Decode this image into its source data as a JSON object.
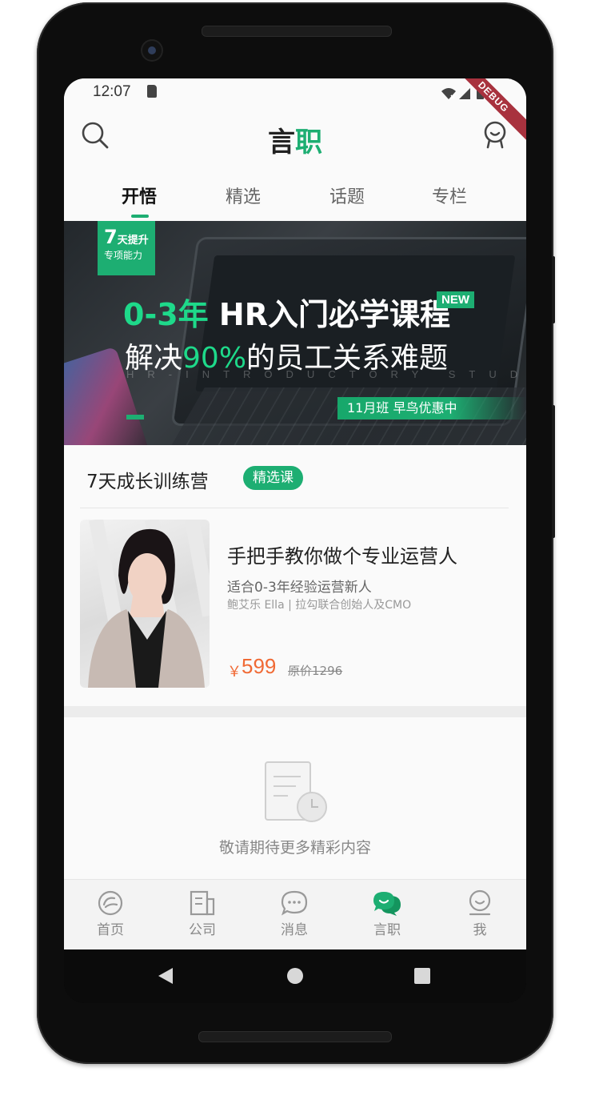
{
  "status_bar": {
    "time": "12:07",
    "debug_label": "DEBUG"
  },
  "app_bar": {
    "title_part1": "言",
    "title_part2": "职"
  },
  "tabs": [
    {
      "label": "开悟",
      "active": true
    },
    {
      "label": "精选",
      "active": false
    },
    {
      "label": "话题",
      "active": false
    },
    {
      "label": "专栏",
      "active": false
    }
  ],
  "banner": {
    "badge_num": "7",
    "badge_line1": "天提升",
    "badge_line2": "专项能力",
    "headline_accent": "0-3年",
    "headline_rest": " HR入门必学课程",
    "new_tag": "NEW",
    "subline_a": "解决",
    "subline_accent": "90%",
    "subline_b": "的员工关系难题",
    "watermark": "HR-INTRODUCTORY STUDY",
    "promo": "11月班 早鸟优惠中"
  },
  "section": {
    "title": "7天成长训练营",
    "badge": "精选课",
    "course": {
      "title": "手把手教你做个专业运营人",
      "desc": "适合0-3年经验运营新人",
      "author": "鲍艾乐 Ella | 拉勾联合创始人及CMO",
      "price_currency": "￥",
      "price": "599",
      "original_price": "原价1296"
    }
  },
  "empty_state": {
    "text": "敬请期待更多精彩内容"
  },
  "bottom_nav": [
    {
      "label": "首页",
      "icon": "home-icon",
      "active": false
    },
    {
      "label": "公司",
      "icon": "company-icon",
      "active": false
    },
    {
      "label": "消息",
      "icon": "message-icon",
      "active": false
    },
    {
      "label": "言职",
      "icon": "yanzhi-icon",
      "active": true
    },
    {
      "label": "我",
      "icon": "profile-icon",
      "active": false
    }
  ],
  "colors": {
    "accent": "#1dae72",
    "price": "#f06a35",
    "debug": "#a8323e"
  }
}
